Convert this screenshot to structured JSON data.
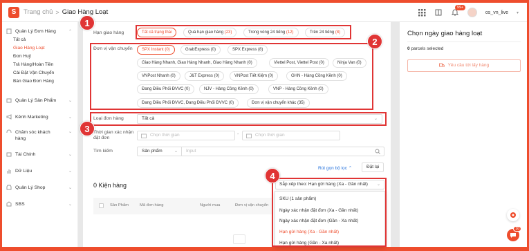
{
  "header": {
    "breadcrumb_home": "Trang chủ",
    "breadcrumb_sep": ">",
    "breadcrumb_current": "Giao Hàng Loạt",
    "notification_count": "99+",
    "username": "os_vn_live"
  },
  "sidebar": {
    "sections": [
      {
        "label": "Quản Lý Đơn Hàng",
        "icon": "clipboard-icon"
      },
      {
        "label": "Quản Lý Sản Phẩm",
        "icon": "box-icon"
      },
      {
        "label": "Kênh Marketing",
        "icon": "megaphone-icon"
      },
      {
        "label": "Chăm sóc khách hàng",
        "icon": "headset-icon"
      },
      {
        "label": "Tài Chính",
        "icon": "wallet-icon"
      },
      {
        "label": "Dữ Liệu",
        "icon": "chart-icon"
      },
      {
        "label": "Quản Lý Shop",
        "icon": "shop-icon"
      },
      {
        "label": "SBS",
        "icon": "warehouse-icon"
      }
    ],
    "order_items": [
      "Tất cả",
      "Giao Hàng Loạt",
      "Đơn Huỷ",
      "Trả Hàng/Hoàn Tiền",
      "Cài Đặt Vận Chuyển",
      "Bàn Giao Đơn Hàng"
    ],
    "active_item": "Giao Hàng Loạt"
  },
  "filters": {
    "status_label": "Hạn giao hàng",
    "status_pills": [
      {
        "label": "Tất cả trạng thái",
        "count": ""
      },
      {
        "label": "Quá hạn giao hàng",
        "count": "(23)"
      },
      {
        "label": "Trong vòng 24 tiếng",
        "count": "(12)"
      },
      {
        "label": "Trên 24 tiếng",
        "count": "(8)"
      }
    ],
    "carrier_label": "Đơn vị vận chuyển",
    "carrier_pills": [
      "SPX Instant (0)",
      "GrabExpress (0)",
      "SPX Express (8)",
      "Giao Hàng Nhanh, Giao Hàng Nhanh, Giao Hàng Nhanh (0)",
      "Viettel Post, Viettel Post (0)",
      "Ninja Van (0)",
      "VNPost Nhanh (0)",
      "J&T Express (0)",
      "VNPost Tiết Kiệm (0)",
      "GHN - Hàng Cồng Kềnh (0)",
      "Đang Điều Phối ĐVVC (0)",
      "NJV - Hàng Cồng Kềnh (0)",
      "VNP - Hàng Cồng Kềnh (0)",
      "Đang Điều Phối ĐVVC, Đang Điều Phối ĐVVC (0)",
      "Đơn vị vận chuyển khác (35)"
    ],
    "order_type_label": "Loại đơn hàng",
    "order_type_value": "Tất cả",
    "confirm_time_label": "Thời gian xác nhận đặt đơn",
    "date_placeholder_start": "Chọn thời gian",
    "date_placeholder_end": "Chọn thời gian",
    "date_dash": "-",
    "search_label": "Tìm kiếm",
    "search_type": "Sản phẩm",
    "search_placeholder": "Input",
    "collapse_link": "Rút gọn bộ lọc ⌃",
    "reset_button": "Đặt lại"
  },
  "orders": {
    "count_title": "0 Kiện hàng",
    "sort_label": "Sắp xếp theo: Hạn gửi hàng (Xa - Gần nhất)",
    "columns": [
      "Sản Phẩm",
      "Mã đơn hàng",
      "Người mua",
      "Đơn vị vận chuyển"
    ],
    "sort_options": [
      "SKU (1 sản phẩm)",
      "Ngày xác nhận đặt đơn (Xa - Gần nhất)",
      "Ngày xác nhận đặt đơn (Gần - Xa nhất)",
      "Hạn gửi hàng (Xa - Gần nhất)",
      "Hạn gửi hàng (Gần - Xa nhất)"
    ],
    "active_sort_option": "Hạn gửi hàng (Xa - Gần nhất)"
  },
  "right_panel": {
    "title": "Chọn ngày giao hàng loạt",
    "parcels_count": "0",
    "parcels_text": "parcels selected",
    "request_button": "Yêu cầu tới lấy hàng"
  },
  "annotations": [
    "1",
    "2",
    "3",
    "4"
  ],
  "chat_badge": "10",
  "colors": {
    "brand": "#ee4d2d",
    "annotation": "#e03535",
    "link": "#2673dd"
  }
}
